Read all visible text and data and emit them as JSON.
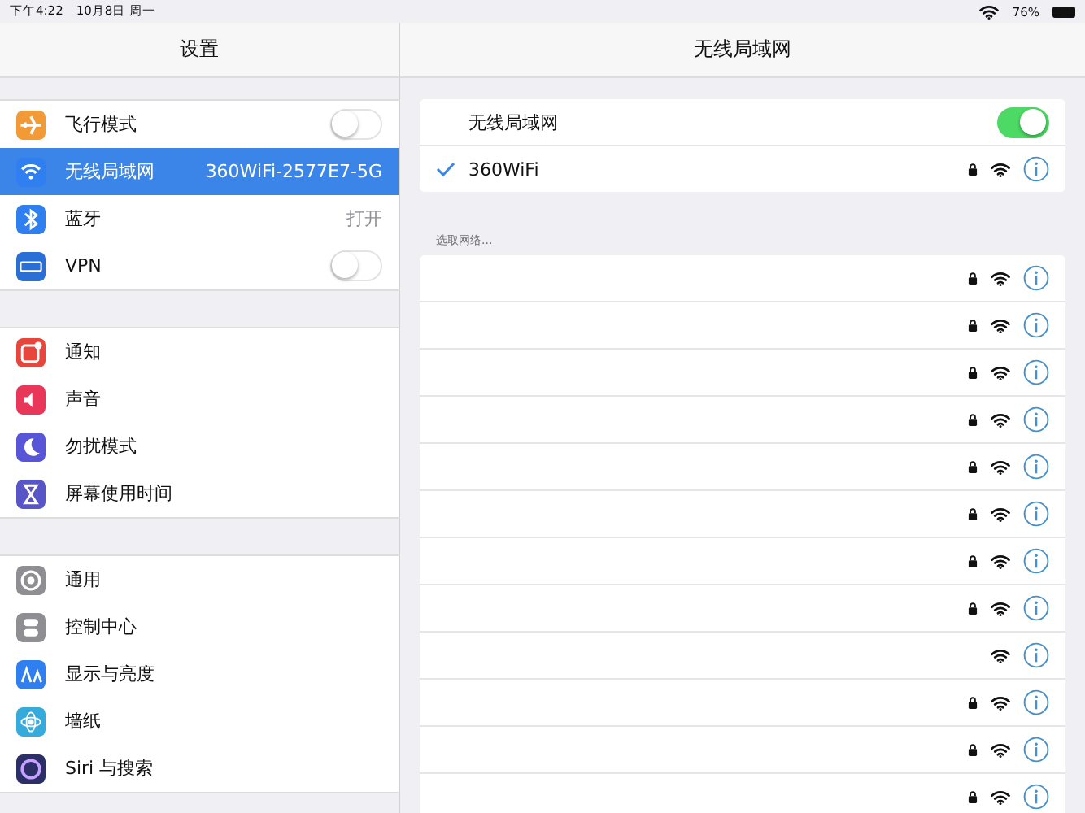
{
  "status_bar": {
    "time": "下午4:22",
    "date": "10月8日 周一",
    "battery": "76%"
  },
  "sidebar": {
    "title": "设置",
    "sections": [
      {
        "items": [
          {
            "label": "飞行模式",
            "kind": "toggle",
            "on": false,
            "selected": false,
            "color": "#f19a37"
          },
          {
            "label": "无线局域网",
            "kind": "value",
            "value": "360WiFi-2577E7-5G",
            "selected": true,
            "color": "#2f7ff0"
          },
          {
            "label": "蓝牙",
            "kind": "value",
            "value": "打开",
            "selected": false,
            "color": "#2f7ff0"
          },
          {
            "label": "VPN",
            "kind": "toggle",
            "on": false,
            "selected": false,
            "color": "#2a6fd6"
          }
        ]
      },
      {
        "items": [
          {
            "label": "通知",
            "kind": "link",
            "selected": false,
            "color": "#e8453c"
          },
          {
            "label": "声音",
            "kind": "link",
            "selected": false,
            "color": "#e9375a"
          },
          {
            "label": "勿扰模式",
            "kind": "link",
            "selected": false,
            "color": "#5856d6"
          },
          {
            "label": "屏幕使用时间",
            "kind": "link",
            "selected": false,
            "color": "#5856c6"
          }
        ]
      },
      {
        "items": [
          {
            "label": "通用",
            "kind": "link",
            "selected": false,
            "color": "#8e8e93"
          },
          {
            "label": "控制中心",
            "kind": "link",
            "selected": false,
            "color": "#8e8e93"
          },
          {
            "label": "显示与亮度",
            "kind": "link",
            "selected": false,
            "color": "#2f7ff0"
          },
          {
            "label": "墙纸",
            "kind": "link",
            "selected": false,
            "color": "#36aadc"
          },
          {
            "label": "Siri 与搜索",
            "kind": "link",
            "selected": false,
            "color": "#2b2f66"
          }
        ]
      }
    ]
  },
  "detail": {
    "title": "无线局域网",
    "wifi_toggle": {
      "label": "无线局域网",
      "on": true
    },
    "connected": {
      "name": "360WiFi",
      "locked": true
    },
    "section_label": "选取网络...",
    "networks": [
      {
        "locked": true
      },
      {
        "locked": true
      },
      {
        "locked": true
      },
      {
        "locked": true
      },
      {
        "locked": true
      },
      {
        "locked": true
      },
      {
        "locked": true
      },
      {
        "locked": true
      },
      {
        "locked": false
      },
      {
        "locked": true
      },
      {
        "locked": true
      },
      {
        "locked": true
      }
    ]
  }
}
